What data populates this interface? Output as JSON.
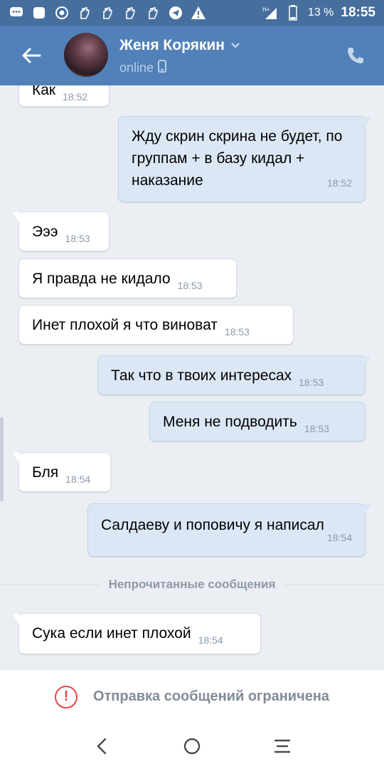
{
  "status_bar": {
    "left_icons": [
      "chat-bubble-icon",
      "square-app-icon",
      "chrome-icon",
      "hand-icon",
      "hand-icon",
      "hand-icon",
      "hand-icon",
      "telegram-icon",
      "warning-icon"
    ],
    "network": "H+",
    "battery": "13 %",
    "time": "18:55"
  },
  "header": {
    "name": "Женя Корякин",
    "status": "online",
    "accent": "#5181b8"
  },
  "messages": [
    {
      "dir": "in",
      "text": "Как",
      "time": "18:52"
    },
    {
      "dir": "out",
      "text": "Жду скрин скрина не будет, по группам + в базу кидал + наказание",
      "time": "18:52"
    },
    {
      "dir": "in",
      "text": "Эээ",
      "time": "18:53"
    },
    {
      "dir": "in",
      "text": "Я правда не кидало",
      "time": "18:53"
    },
    {
      "dir": "in",
      "text": "Инет плохой я что виноват",
      "time": "18:53"
    },
    {
      "dir": "out",
      "text": "Так что в твоих интересах",
      "time": "18:53"
    },
    {
      "dir": "out",
      "text": "Меня не подводить",
      "time": "18:53"
    },
    {
      "dir": "in",
      "text": "Бля",
      "time": "18:54"
    },
    {
      "dir": "out",
      "text": "Салдаеву и поповичу я написал",
      "time": "18:54"
    },
    {
      "dir": "in",
      "text": "Сука если инет плохой",
      "time": "18:54"
    }
  ],
  "unread_divider": "Непрочитанные сообщения",
  "restriction": {
    "text": "Отправка сообщений ограничена",
    "icon": "!"
  },
  "nav": [
    "back-icon",
    "home-icon",
    "menu-icon"
  ]
}
